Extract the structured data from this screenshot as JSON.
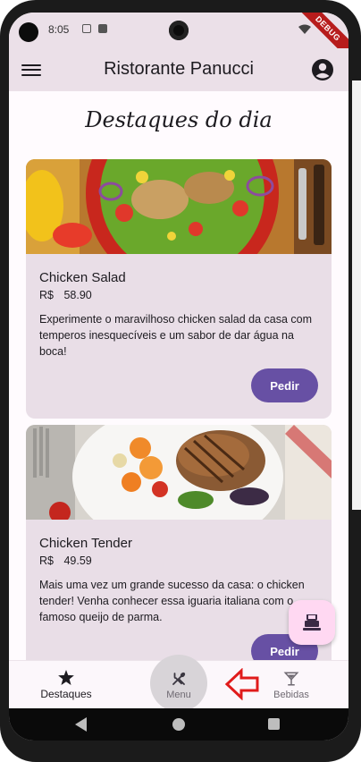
{
  "status": {
    "time": "8:05",
    "debug_label": "DEBUG"
  },
  "app_bar": {
    "title": "Ristorante Panucci"
  },
  "section": {
    "title": "Destaques do dia"
  },
  "cards": [
    {
      "name": "Chicken Salad",
      "currency": "R$",
      "price": "58.90",
      "description": "Experimente o maravilhoso chicken salad da casa com temperos inesquecíveis e um sabor de dar água na boca!",
      "button": "Pedir"
    },
    {
      "name": "Chicken Tender",
      "currency": "R$",
      "price": "49.59",
      "description": "Mais uma vez um grande sucesso da casa: o chicken tender! Venha conhecer essa iguaria italiana com o famoso queijo de parma.",
      "button": "Pedir"
    }
  ],
  "bottom_nav": {
    "items": [
      {
        "label": "Destaques",
        "icon": "star-icon"
      },
      {
        "label": "Menu",
        "icon": "restaurant-icon"
      },
      {
        "label": "Bebidas",
        "icon": "cocktail-icon"
      }
    ]
  },
  "colors": {
    "primary": "#6750a4",
    "surface": "#e9dee7",
    "app_bar": "#ebe0e8",
    "fab": "#ffd8f2",
    "annotation": "#e01b1b"
  }
}
